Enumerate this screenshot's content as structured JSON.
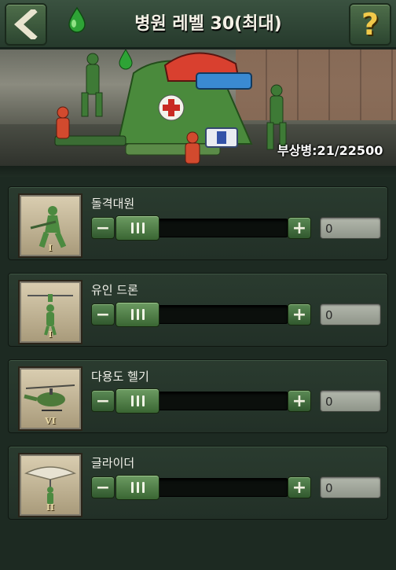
{
  "header": {
    "title": "병원 레벨 30(최대)",
    "back_icon": "chevron-left-icon",
    "help_label": "?",
    "drop_icon": "green-drop-icon"
  },
  "banner": {
    "injured_text": "부상병:21/22500"
  },
  "units": [
    {
      "name": "돌격대원",
      "rank": "I",
      "quantity": "0",
      "minus": "−",
      "plus": "+",
      "icon": "rifleman-icon"
    },
    {
      "name": "유인 드론",
      "rank": "I",
      "quantity": "0",
      "minus": "−",
      "plus": "+",
      "icon": "drone-icon"
    },
    {
      "name": "다용도 헬기",
      "rank": "VI",
      "quantity": "0",
      "minus": "−",
      "plus": "+",
      "icon": "helicopter-icon"
    },
    {
      "name": "글라이더",
      "rank": "II",
      "quantity": "0",
      "minus": "−",
      "plus": "+",
      "icon": "glider-icon"
    }
  ],
  "colors": {
    "accent_green": "#3f6e39",
    "help_yellow": "#f1c94a",
    "background": "#1d2a22"
  }
}
